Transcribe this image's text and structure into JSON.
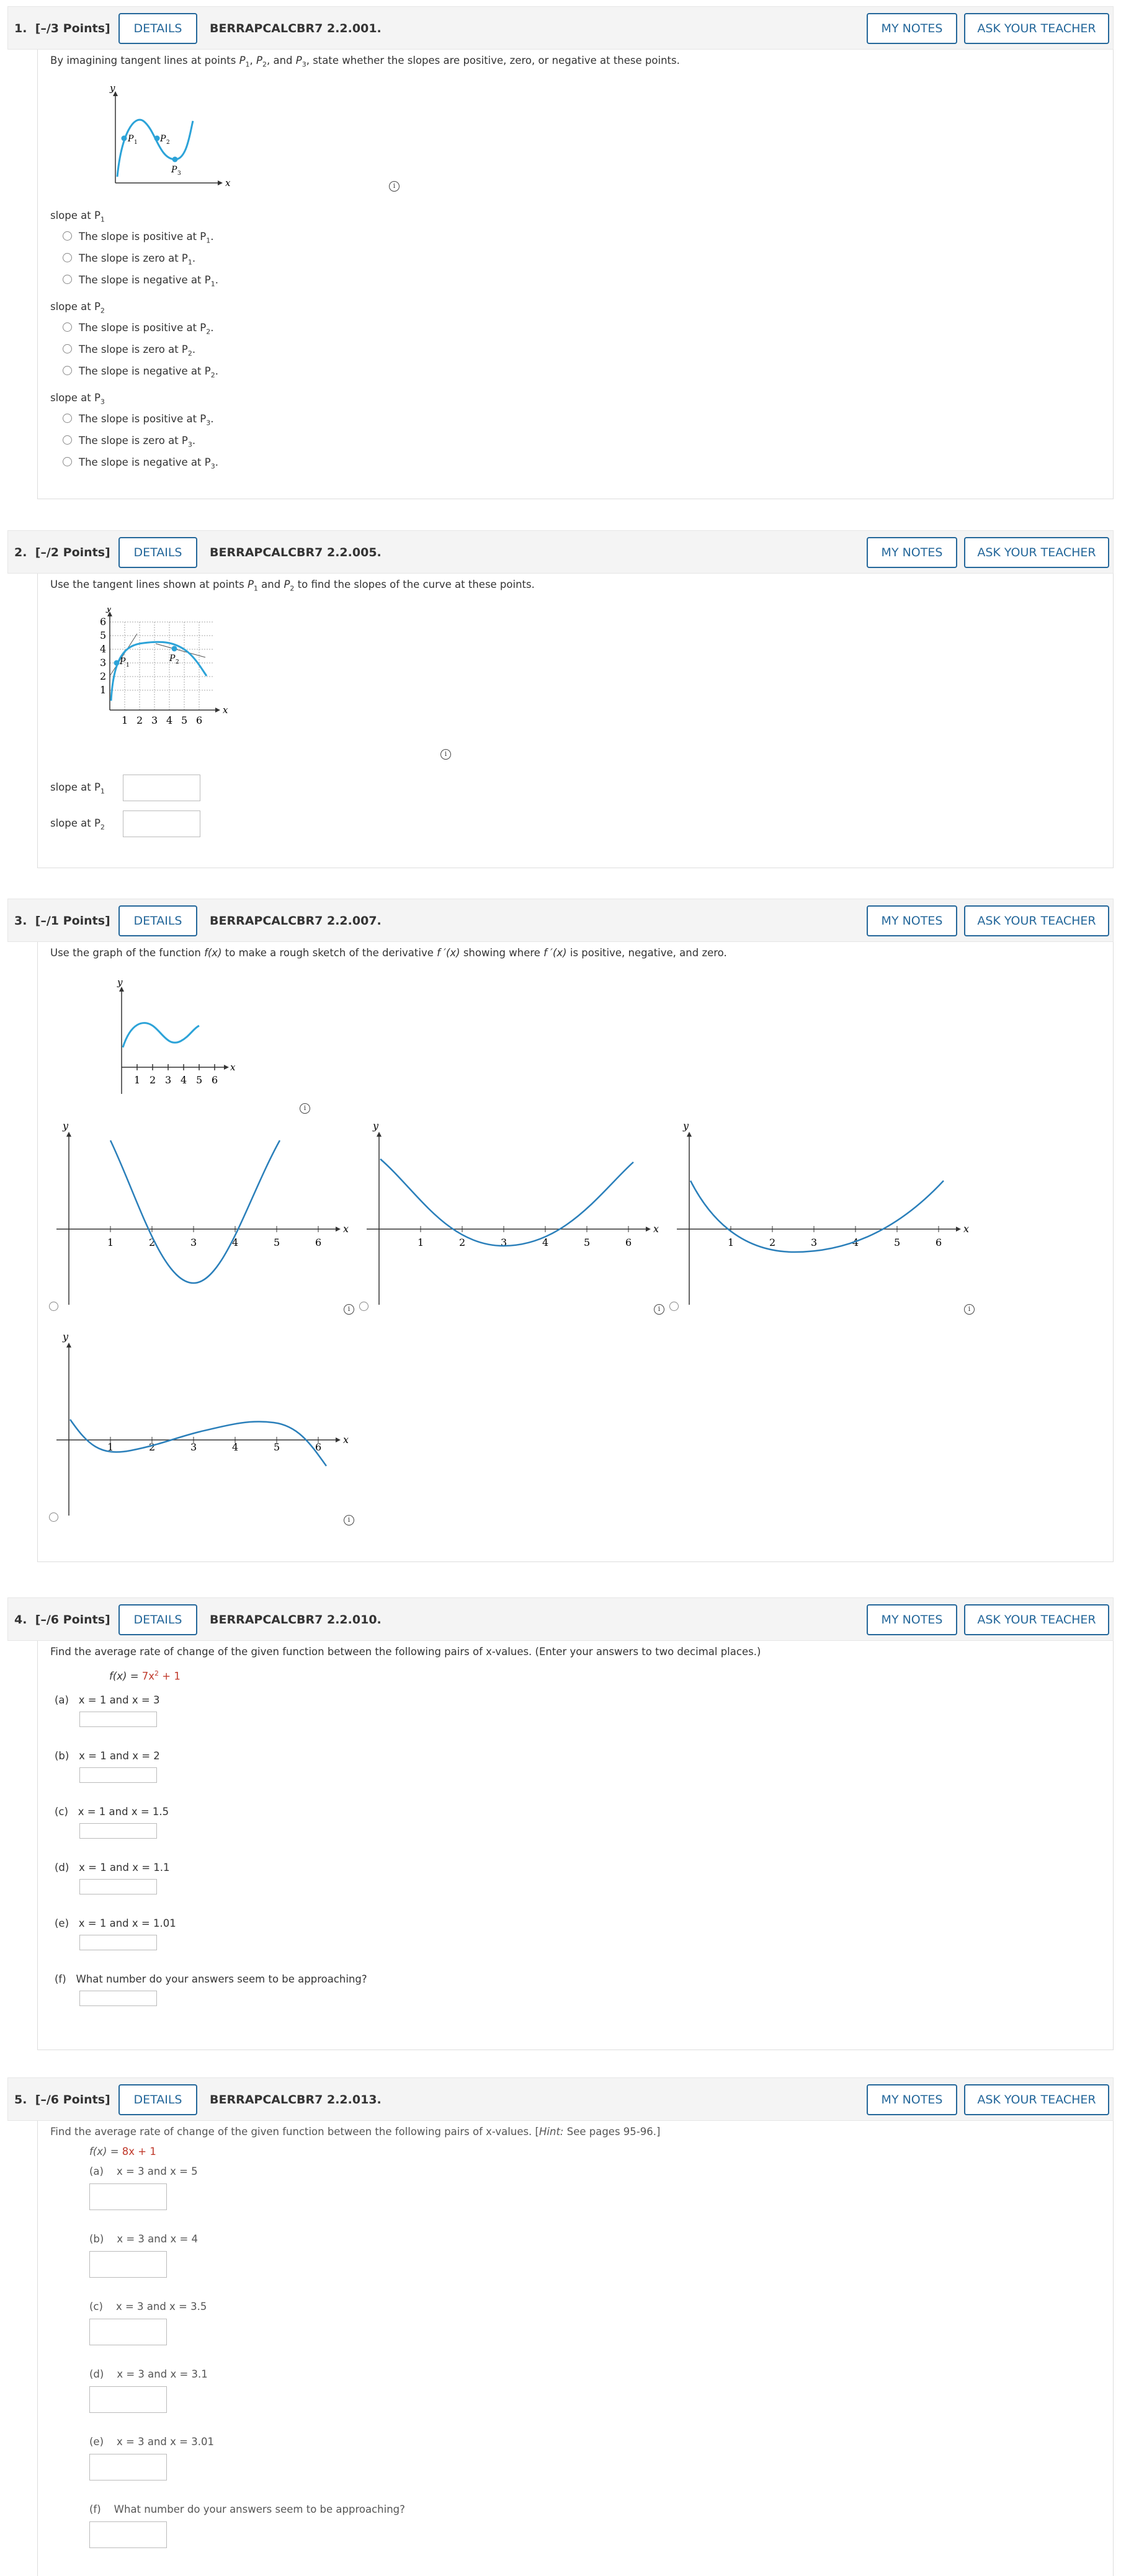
{
  "buttons": {
    "details": "DETAILS",
    "my_notes": "MY NOTES",
    "ask_teacher": "ASK YOUR TEACHER"
  },
  "q1": {
    "number": "1.",
    "points": "[–/3 Points]",
    "code": "BERRAPCALCBR7 2.2.001.",
    "prompt_a": "By imagining tangent lines at points ",
    "prompt_b": ", state whether the slopes are positive, zero, or negative at these points.",
    "graph_labels": {
      "y": "y",
      "x": "x",
      "p1": "P",
      "p2": "P",
      "p3": "P"
    },
    "groups": [
      {
        "label": "slope at P",
        "sub": "1",
        "options": [
          "The slope is positive at P",
          "The slope is zero at P",
          "The slope is negative at P"
        ]
      },
      {
        "label": "slope at P",
        "sub": "2",
        "options": [
          "The slope is positive at P",
          "The slope is zero at P",
          "The slope is negative at P"
        ]
      },
      {
        "label": "slope at P",
        "sub": "3",
        "options": [
          "The slope is positive at P",
          "The slope is zero at P",
          "The slope is negative at P"
        ]
      }
    ]
  },
  "q2": {
    "number": "2.",
    "points": "[–/2 Points]",
    "code": "BERRAPCALCBR7 2.2.005.",
    "prompt_a": "Use the tangent lines shown at points ",
    "prompt_b": " to find the slopes of the curve at these points.",
    "graph": {
      "y": "y",
      "x": "x",
      "yticks": [
        "1",
        "2",
        "3",
        "4",
        "5",
        "6"
      ],
      "xticks": [
        "1",
        "2",
        "3",
        "4",
        "5",
        "6"
      ]
    },
    "slope_p1": "slope at P",
    "slope_p2": "slope at P"
  },
  "q3": {
    "number": "3.",
    "points": "[–/1 Points]",
    "code": "BERRAPCALCBR7 2.2.007.",
    "prompt_a": "Use the graph of the function ",
    "prompt_b": " to make a rough sketch of the derivative ",
    "prompt_c": " showing where ",
    "prompt_d": " is positive, negative, and zero.",
    "fx": "f(x)",
    "fpx": "f ′(x)",
    "axis": {
      "x": "x",
      "y": "y",
      "ticks": [
        "1",
        "2",
        "3",
        "4",
        "5",
        "6"
      ]
    }
  },
  "q4": {
    "number": "4.",
    "points": "[–/6 Points]",
    "code": "BERRAPCALCBR7 2.2.010.",
    "prompt": "Find the average rate of change of the given function between the following pairs of x-values. (Enter your answers to two decimal places.)",
    "func_left": "f(x) = ",
    "func_right": "7x",
    "func_exp": "2",
    "func_end": " + 1",
    "parts": [
      {
        "tag": "(a)",
        "text": "x = 1 and x = 3"
      },
      {
        "tag": "(b)",
        "text": "x = 1 and x = 2"
      },
      {
        "tag": "(c)",
        "text": "x = 1 and x = 1.5"
      },
      {
        "tag": "(d)",
        "text": "x = 1 and x = 1.1"
      },
      {
        "tag": "(e)",
        "text": "x = 1 and x = 1.01"
      },
      {
        "tag": "(f)",
        "text": "What number do your answers seem to be approaching?"
      }
    ]
  },
  "q5": {
    "number": "5.",
    "points": "[–/6 Points]",
    "code": "BERRAPCALCBR7 2.2.013.",
    "prompt_a": "Find the average rate of change of the given function between the following pairs of x-values. [",
    "hint": "Hint:",
    "prompt_b": " See pages 95-96.]",
    "func_left": "f(x) = ",
    "func_right": "8x + 1",
    "parts": [
      {
        "tag": "(a)",
        "text": "x = 3 and x = 5"
      },
      {
        "tag": "(b)",
        "text": "x = 3 and x = 4"
      },
      {
        "tag": "(c)",
        "text": "x = 3 and x = 3.5"
      },
      {
        "tag": "(d)",
        "text": "x = 3 and x = 3.1"
      },
      {
        "tag": "(e)",
        "text": "x = 3 and x = 3.01"
      },
      {
        "tag": "(f)",
        "text": "What number do your answers seem to be approaching?"
      }
    ]
  }
}
